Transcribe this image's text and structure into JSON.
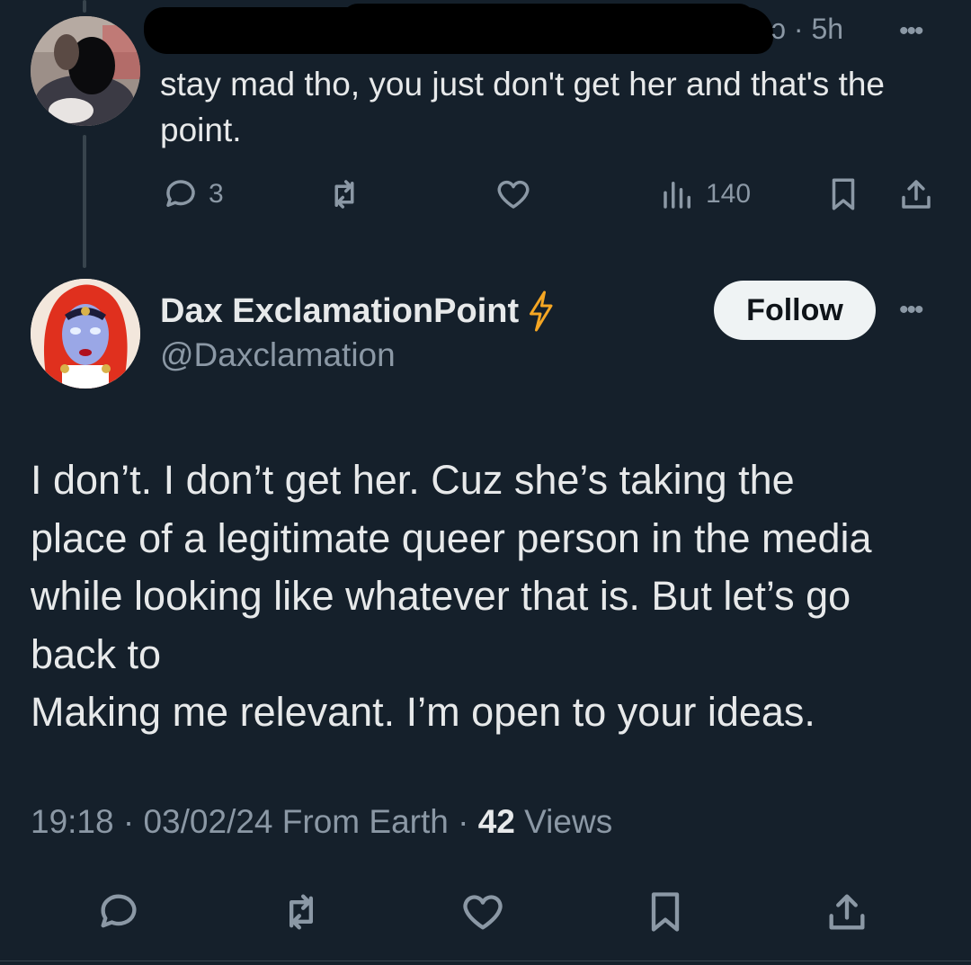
{
  "reply": {
    "meta": "ɔ · 5h",
    "more_label": "•••",
    "text": "stay mad tho, you just don't get her and that's the point.",
    "actions": {
      "reply_count": "3",
      "repost_count": "",
      "like_count": "",
      "views_count": "140"
    }
  },
  "tweet": {
    "display_name": "Dax ExclamationPoint",
    "handle": "@Daxclamation",
    "follow_label": "Follow",
    "more_label": "•••",
    "text_lines": [
      "I don’t. I don’t get her. Cuz she’s taking the",
      "place of a legitimate queer person in the media",
      "while looking like whatever that is. But let’s go",
      "back to",
      "Making me relevant. I’m open to your ideas."
    ],
    "meta": {
      "time": "19:18",
      "date": "03/02/24",
      "source": "From Earth",
      "views_count": "42",
      "views_label": "Views"
    }
  },
  "icons": {
    "reply": "reply-icon",
    "repost": "repost-icon",
    "like": "heart-icon",
    "views": "views-icon",
    "bookmark": "bookmark-icon",
    "share": "share-icon",
    "verified": "lightning-bolt-icon"
  },
  "colors": {
    "background": "#15202b",
    "text_primary": "#e7e9ea",
    "text_secondary": "#8b98a5",
    "follow_bg": "#eff3f4",
    "bolt": "#f5a623"
  }
}
